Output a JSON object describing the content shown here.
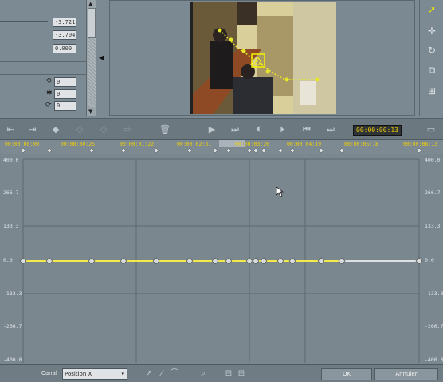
{
  "params": {
    "fields": [
      "-3.721",
      "-3.704",
      "0.000"
    ],
    "rot_fields": [
      "0",
      "0",
      "0"
    ]
  },
  "toolbar": {
    "buttons": [
      "prev-key",
      "next-key",
      "add-key",
      "key-a",
      "key-b",
      "key-c",
      "trash",
      "play",
      "play-to-end",
      "step-back",
      "step-forward",
      "go-start",
      "go-end"
    ],
    "timecode": "00:00:00:13"
  },
  "ruler": {
    "ticks": [
      "00:00:00:00",
      "00:00:00:25",
      "00:00:01:22",
      "00:00:02:31",
      "00:00:03:26",
      "00:00:04:19",
      "00:00:05:18",
      "00:00:06:13"
    ]
  },
  "graph": {
    "y_labels": [
      "400.0",
      "266.7",
      "133.3",
      "0.0",
      "-133.3",
      "-266.7",
      "-400.0"
    ],
    "y_labels_right": [
      "400.0",
      "266.7",
      "133.3",
      "0.0",
      "-133.3",
      "-266.7",
      "-400.0"
    ],
    "keyframe_count": 16,
    "curve_value": 0.0,
    "curve_color": "#f2e94a"
  },
  "bottom": {
    "channel_label": "Canal",
    "channel_value": "Position X",
    "ok_label": "OK",
    "cancel_label": "Annuler"
  },
  "colors": {
    "panel": "#7c8a93",
    "graph_bg": "#7a878f",
    "timecode_text": "#f0c800",
    "ruler_text": "#f2d000"
  }
}
